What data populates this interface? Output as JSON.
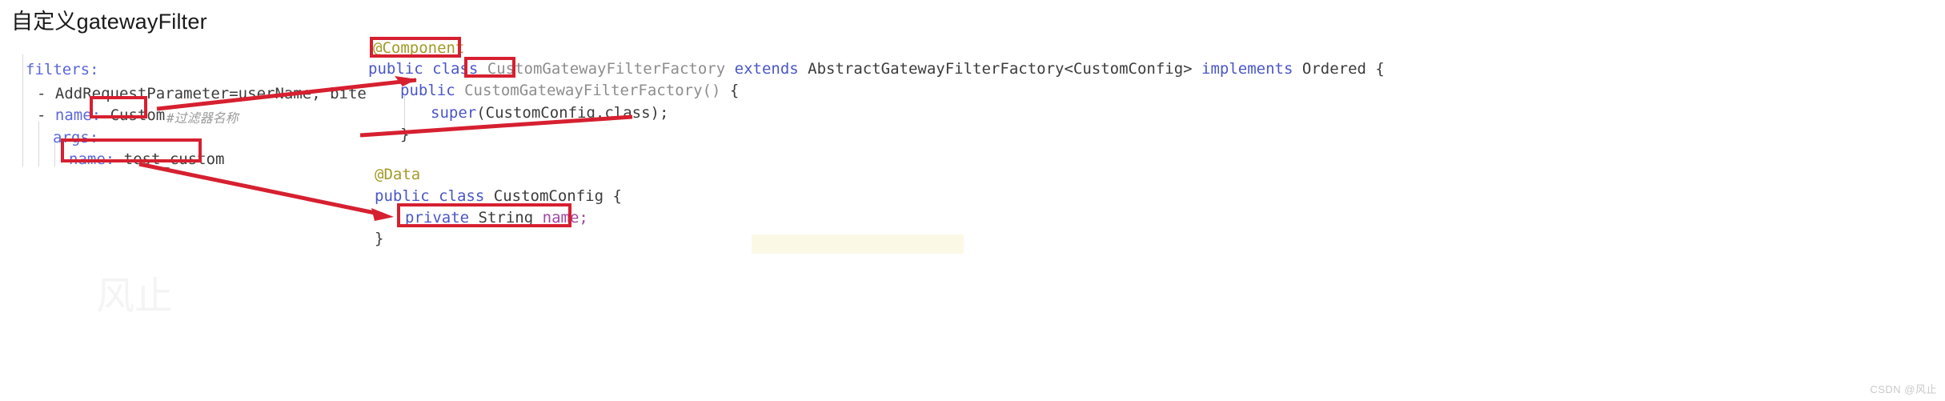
{
  "page": {
    "title": "自定义gatewayFilter",
    "watermark": "CSDN @风止",
    "ghost_watermark": "风止",
    "accent_color": "#d62030",
    "background": "#ffffff"
  },
  "yaml": {
    "lines": [
      {
        "indent": 0,
        "key": "filters:",
        "dash": "",
        "value": "",
        "comment": ""
      },
      {
        "indent": 1,
        "key": "",
        "dash": "-",
        "value": "AddRequestParameter=userName, bite",
        "comment": ""
      },
      {
        "indent": 1,
        "key": "name:",
        "dash": "-",
        "value": "Custom",
        "comment": "#过滤器名称"
      },
      {
        "indent": 2,
        "key": "args:",
        "dash": "",
        "value": "",
        "comment": ""
      },
      {
        "indent": 3,
        "key": "name:",
        "dash": "",
        "value": "test_custom",
        "comment": ""
      }
    ],
    "filters_label": "filters:",
    "dash": "-",
    "add_request_parameter": "AddRequestParameter=userName, bite",
    "name_key": "name:",
    "name_value": "Custom",
    "name_comment": "#过滤器名称",
    "args_key": "args:",
    "arg_name_key": "name:",
    "arg_name_value": "test_custom"
  },
  "java": {
    "factory": {
      "annotation": "@Component",
      "decl_public": "public",
      "decl_class": "class",
      "decl_name_boxed": "Custom",
      "decl_name_rest": "GatewayFilterFactory",
      "decl_extends": "extends",
      "decl_super": "AbstractGatewayFilterFactory<CustomConfig>",
      "decl_implements": "implements",
      "decl_interface": "Ordered",
      "decl_brace": "{",
      "ctor_public": "public",
      "ctor_name": "CustomGatewayFilterFactory()",
      "ctor_brace": "{",
      "super_call_kw": "super",
      "super_call_args": "(CustomConfig.class);",
      "ctor_close": "}"
    },
    "config": {
      "annotation": "@Data",
      "decl_public": "public",
      "decl_class": "class",
      "decl_name": "CustomConfig",
      "decl_brace": "{",
      "field_modifier": "private",
      "field_type": "String",
      "field_name": "name;",
      "class_close": "}"
    }
  },
  "annotations": {
    "boxes": [
      {
        "name": "box-yaml-custom",
        "label": "Custom"
      },
      {
        "name": "box-yaml-test-custom",
        "label": "name: test_custom"
      },
      {
        "name": "box-component",
        "label": "@Component"
      },
      {
        "name": "box-class-custom",
        "label": "Custom"
      },
      {
        "name": "box-private-string-name",
        "label": "private String name;"
      }
    ],
    "arrows": [
      {
        "name": "arrow-custom-to-class",
        "from": "yaml Custom box",
        "to": "class Custom token"
      },
      {
        "name": "arrow-testcustom-to-field",
        "from": "yaml name: test_custom box",
        "to": "private String name; box"
      }
    ]
  }
}
